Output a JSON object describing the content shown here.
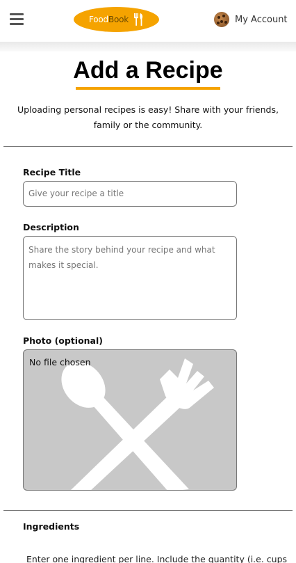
{
  "header": {
    "logo_food": "Food",
    "logo_book": "Book",
    "logo_icon": "cutlery-icon",
    "account_label": "My Account",
    "menu_icon": "hamburger-menu-icon",
    "avatar_icon": "cookie-avatar-icon"
  },
  "page": {
    "title": "Add a Recipe",
    "intro": "Uploading personal recipes is easy! Share with your friends, family or the community."
  },
  "form": {
    "recipe_title": {
      "label": "Recipe Title",
      "placeholder": "Give your recipe a title"
    },
    "description": {
      "label": "Description",
      "placeholder": "Share the story behind your recipe and what makes it special."
    },
    "photo": {
      "label": "Photo (optional)",
      "file_status": "No file chosen",
      "placeholder_icon": "spoon-fork-icon"
    },
    "ingredients": {
      "label": "Ingredients",
      "hint": "Enter one ingredient per line. Include the quantity (i.e. cups"
    }
  },
  "colors": {
    "brand": "#f5a300",
    "accent_underline": "#f5a300",
    "photo_bg": "#c8c8c8",
    "border": "#777777"
  }
}
